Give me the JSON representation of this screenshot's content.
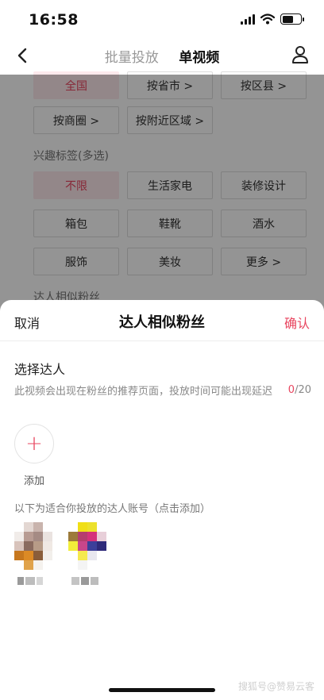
{
  "status_bar": {
    "time": "16:58"
  },
  "header": {
    "tabs": [
      {
        "label": "批量投放",
        "active": false
      },
      {
        "label": "单视频",
        "active": true
      }
    ]
  },
  "background": {
    "location_chips_row1": [
      "全国",
      "按省市 >",
      "按区县 >"
    ],
    "location_chips_row2": [
      "按商圈 >",
      "按附近区域 >"
    ],
    "interest_label": "兴趣标签(多选)",
    "interest_chips_row1": [
      "不限",
      "生活家电",
      "装修设计"
    ],
    "interest_chips_row2": [
      "箱包",
      "鞋靴",
      "酒水"
    ],
    "interest_chips_row3": [
      "服饰",
      "美妆",
      "更多 >"
    ],
    "similar_fans_label": "达人相似粉丝"
  },
  "sheet": {
    "cancel_label": "取消",
    "title": "达人相似粉丝",
    "confirm_label": "确认",
    "select_title": "选择达人",
    "hint": "此视频会出现在粉丝的推荐页面，投放时间可能出现延迟",
    "counter_current": "0",
    "counter_max": "/20",
    "add_label": "添加",
    "suggest_label": "以下为适合你投放的达人账号（点击添加）"
  },
  "watermark": "搜狐号@赞易云客",
  "colors": {
    "accent": "#e8455f",
    "selected_chip_bg": "#fde9ec"
  },
  "icons": {
    "back": "back-arrow-icon",
    "user": "user-icon",
    "add": "plus-icon"
  }
}
